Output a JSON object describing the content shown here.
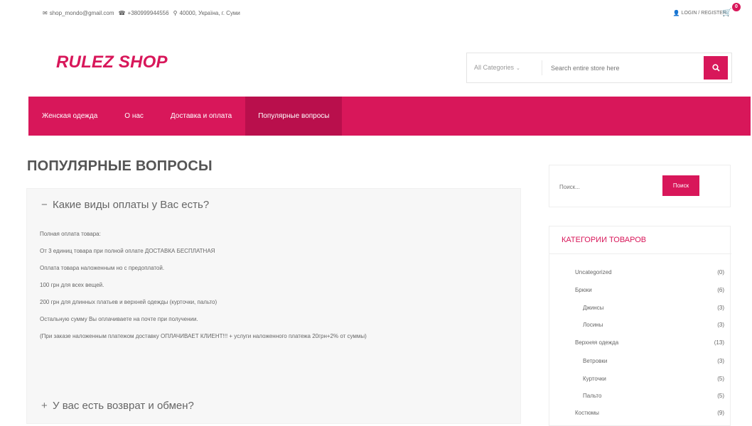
{
  "topbar": {
    "email": "shop_mondo@gmail.com",
    "phone": "+380999944556",
    "address": "40000, Україна, г. Суми",
    "login_label": "LOGIN / REGISTER",
    "cart_count": "0"
  },
  "logo": "RULEZ SHOP",
  "search": {
    "category": "All Categories",
    "placeholder": "Search entire store here"
  },
  "nav": [
    {
      "label": "Женская одежда"
    },
    {
      "label": "О нас"
    },
    {
      "label": "Доставка и оплата"
    },
    {
      "label": "Популярные вопросы"
    }
  ],
  "page_title": "ПОПУЛЯРНЫЕ ВОПРОСЫ",
  "faq": {
    "q1": {
      "sign": "−",
      "text": "Какие виды оплаты у Вас есть?"
    },
    "answer": [
      "Полная оплата товара:",
      "От 3 единиц товара при полной оплате ДОСТАВКА БЕСПЛАТНАЯ",
      "Оплата товара наложенным но с предоплатой.",
      "100 грн для всех вещей.",
      "200 грн для длинных платьев и верхней одежды (курточки, пальто)",
      "Остальную сумму Вы оплачиваете на почте при получении.",
      "(При заказе наложенным платежом доставку ОПЛАЧИВАЕТ КЛИЕНТ!!! + услуги наложенного платежа 20грн+2% от суммы)"
    ],
    "q2": {
      "sign": "+",
      "text": "У вас есть возврат и обмен?"
    }
  },
  "sidebar": {
    "search_placeholder": "Поиск...",
    "search_button": "Поиск",
    "categories_title": "КАТЕГОРИИ ТОВАРОВ",
    "categories": [
      {
        "name": "Uncategorized",
        "count": "(0)"
      },
      {
        "name": "Брюки",
        "count": "(6)"
      },
      {
        "name": "Джинсы",
        "count": "(3)"
      },
      {
        "name": "Лосины",
        "count": "(3)"
      },
      {
        "name": "Верхняя одежда",
        "count": "(13)"
      },
      {
        "name": "Ветровки",
        "count": "(3)"
      },
      {
        "name": "Курточки",
        "count": "(5)"
      },
      {
        "name": "Пальто",
        "count": "(5)"
      },
      {
        "name": "Костюмы",
        "count": "(9)"
      }
    ]
  },
  "colors": {
    "accent": "#d8175a",
    "accent_dark": "#b90f4c"
  }
}
